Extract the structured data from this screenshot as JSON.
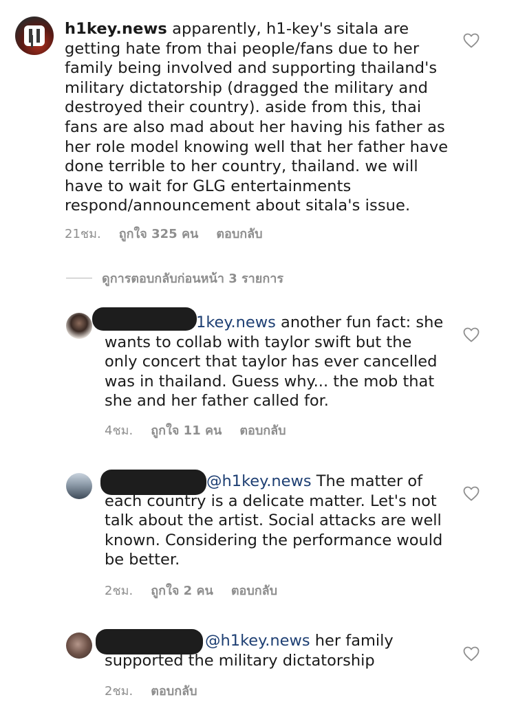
{
  "main_comment": {
    "username": "h1key.news",
    "text": " apparently, h1-key's sitala are getting hate from thai people/fans due to her family being involved and supporting thailand's military dictatorship (dragged the military and destroyed their country). aside from this, thai fans are also mad about her having his father as her role model knowing well that her father have done terrible to her country, thailand. we will have to wait for GLG entertainments respond/announcement about sitala's issue.",
    "time": "21ชม.",
    "likes": "ถูกใจ 325 คน",
    "reply_label": "ตอบกลับ"
  },
  "view_previous_replies": "ดูการตอบกลับก่อนหน้า 3 รายการ",
  "replies": [
    {
      "mention": "1key.news",
      "text": " another fun fact: she wants to collab with taylor swift but the only concert that taylor has ever cancelled was in thailand. Guess why... the mob that she and her father called for.",
      "time": "4ชม.",
      "likes": "ถูกใจ 11 คน",
      "reply_label": "ตอบกลับ"
    },
    {
      "mention": "@h1key.news",
      "text": " The matter of each country is a delicate matter.  Let's not talk about the artist.  Social attacks are well known. Considering the performance would be better.",
      "time": "2ชม.",
      "likes": "ถูกใจ 2 คน",
      "reply_label": "ตอบกลับ"
    },
    {
      "mention": "@h1key.news",
      "text": " her family supported the military dictatorship",
      "time": "2ชม.",
      "reply_label": "ตอบกลับ"
    }
  ],
  "icons": {
    "like": "heart-outline-icon",
    "logo": "h1key-logo"
  },
  "colors": {
    "mention": "#1e3f73",
    "meta_text": "#8e8e8e",
    "redaction": "#1d1d1d"
  }
}
